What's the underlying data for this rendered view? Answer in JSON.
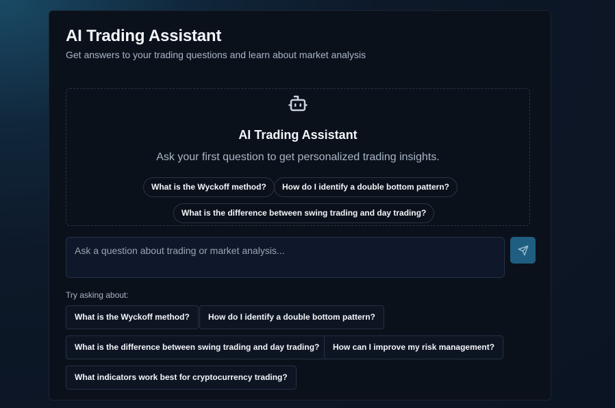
{
  "header": {
    "title": "AI Trading Assistant",
    "subtitle": "Get answers to your trading questions and learn about market analysis"
  },
  "empty_state": {
    "icon": "bot-icon",
    "title": "AI Trading Assistant",
    "text": "Ask your first question to get personalized trading insights.",
    "suggestions": [
      "What is the Wyckoff method?",
      "How do I identify a double bottom pattern?",
      "What is the difference between swing trading and day trading?"
    ]
  },
  "input": {
    "placeholder": "Ask a question about trading or market analysis...",
    "send_icon": "send-icon"
  },
  "try_asking": {
    "label": "Try asking about:",
    "items": [
      "What is the Wyckoff method?",
      "How do I identify a double bottom pattern?",
      "What is the difference between swing trading and day trading?",
      "How can I improve my risk management?",
      "What indicators work best for cryptocurrency trading?"
    ]
  },
  "colors": {
    "accent": "#1f5e80",
    "card_bg": "#0b111b",
    "border": "#2a3444"
  }
}
